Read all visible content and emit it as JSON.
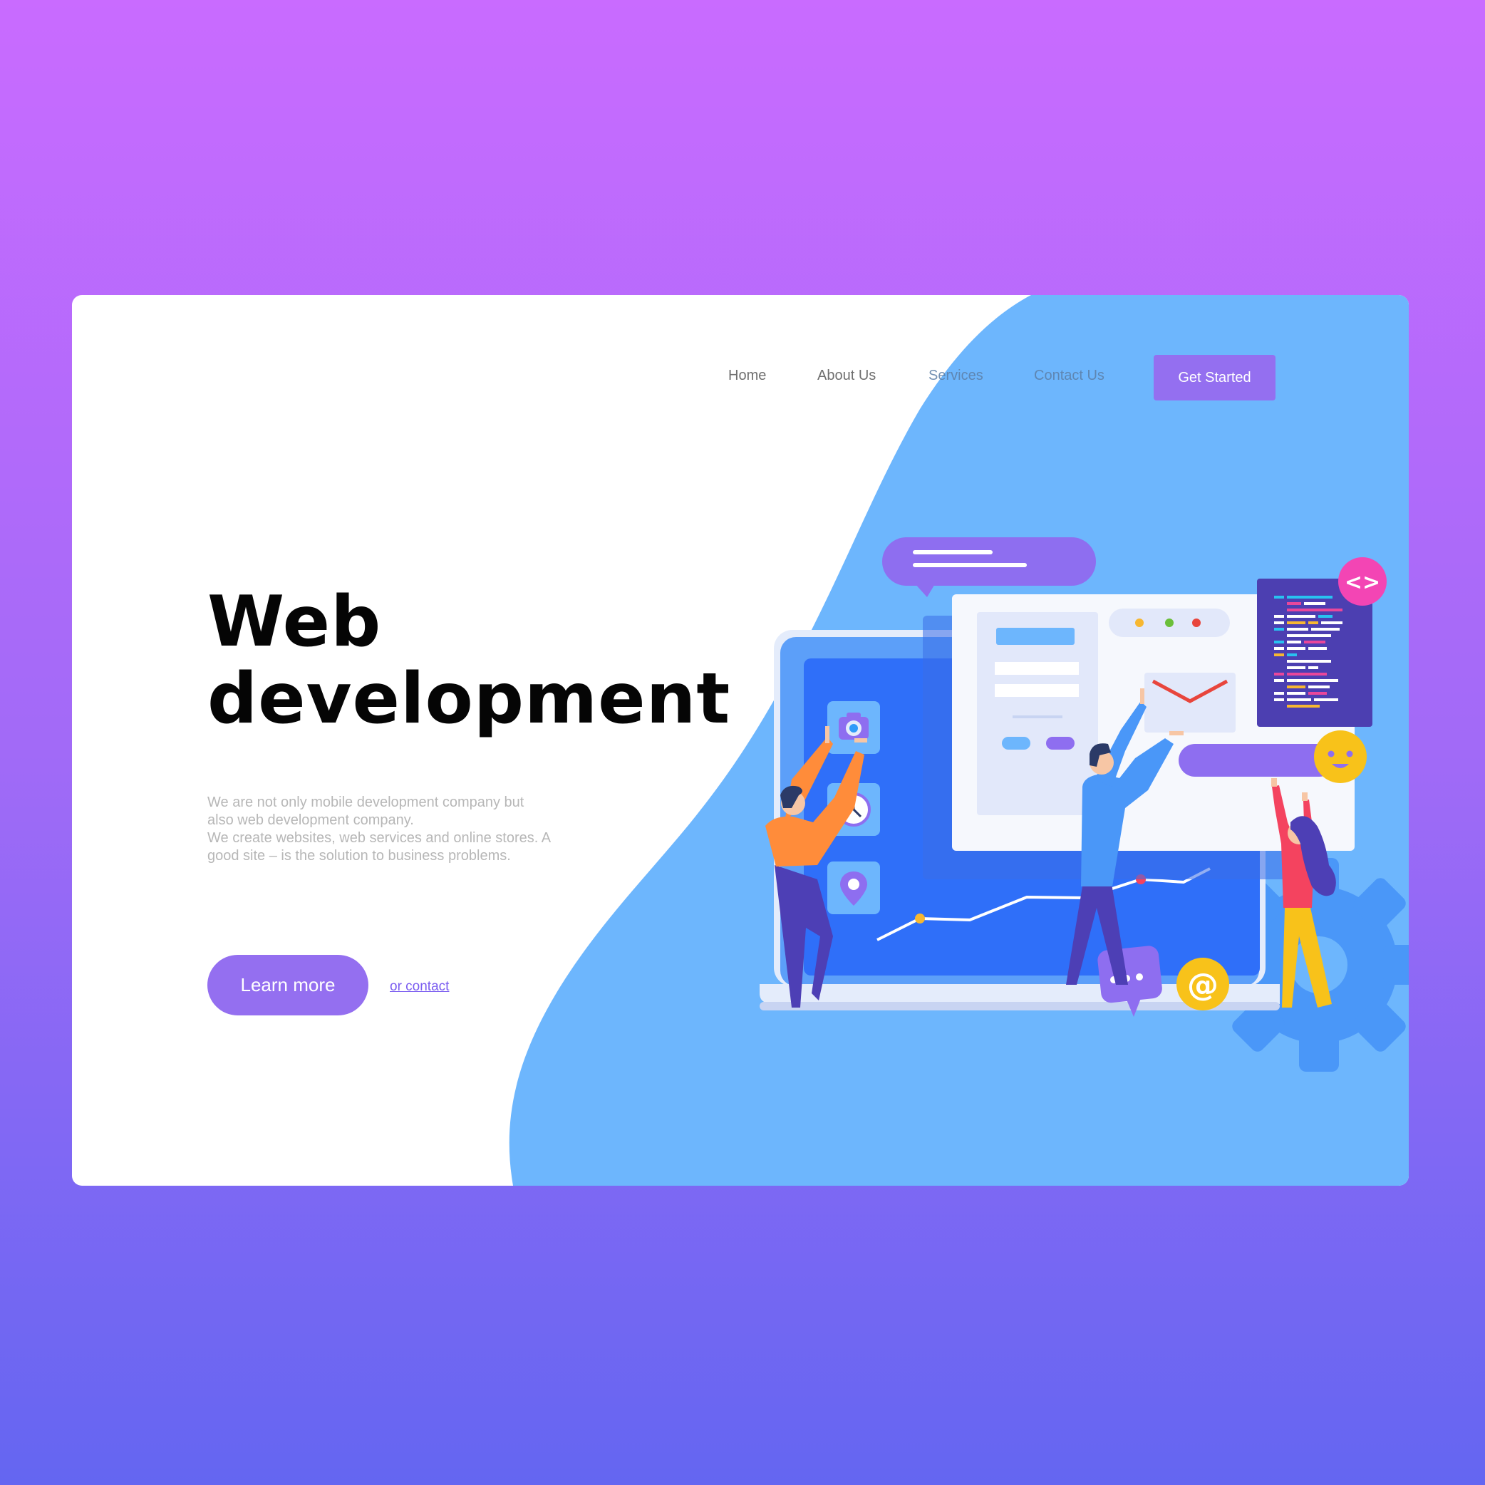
{
  "nav": {
    "items": [
      {
        "label": "Home"
      },
      {
        "label": "About Us"
      },
      {
        "label": "Services"
      },
      {
        "label": "Contact Us"
      }
    ],
    "cta_label": "Get Started"
  },
  "hero": {
    "title_line1": "Web",
    "title_line2": "development",
    "description_lines": [
      "We are not only mobile development company but",
      "also web development company.",
      "We create websites, web services and online stores. A",
      "good site – is the solution to business problems."
    ],
    "learn_more_label": "Learn more",
    "contact_link_label": "or contact"
  },
  "illustration": {
    "code_badge": "<>",
    "email_badge": "@",
    "icons": [
      "camera-icon",
      "clock-icon",
      "location-pin-icon",
      "mail-icon",
      "chat-icon",
      "smiley-icon",
      "gear-icon",
      "code-icon",
      "at-icon"
    ]
  },
  "colors": {
    "background_top": "#c96bff",
    "background_bottom": "#6466f1",
    "accent": "#946ff0",
    "blob": "#6db6fd",
    "screen_blue": "#2f6ff9"
  }
}
